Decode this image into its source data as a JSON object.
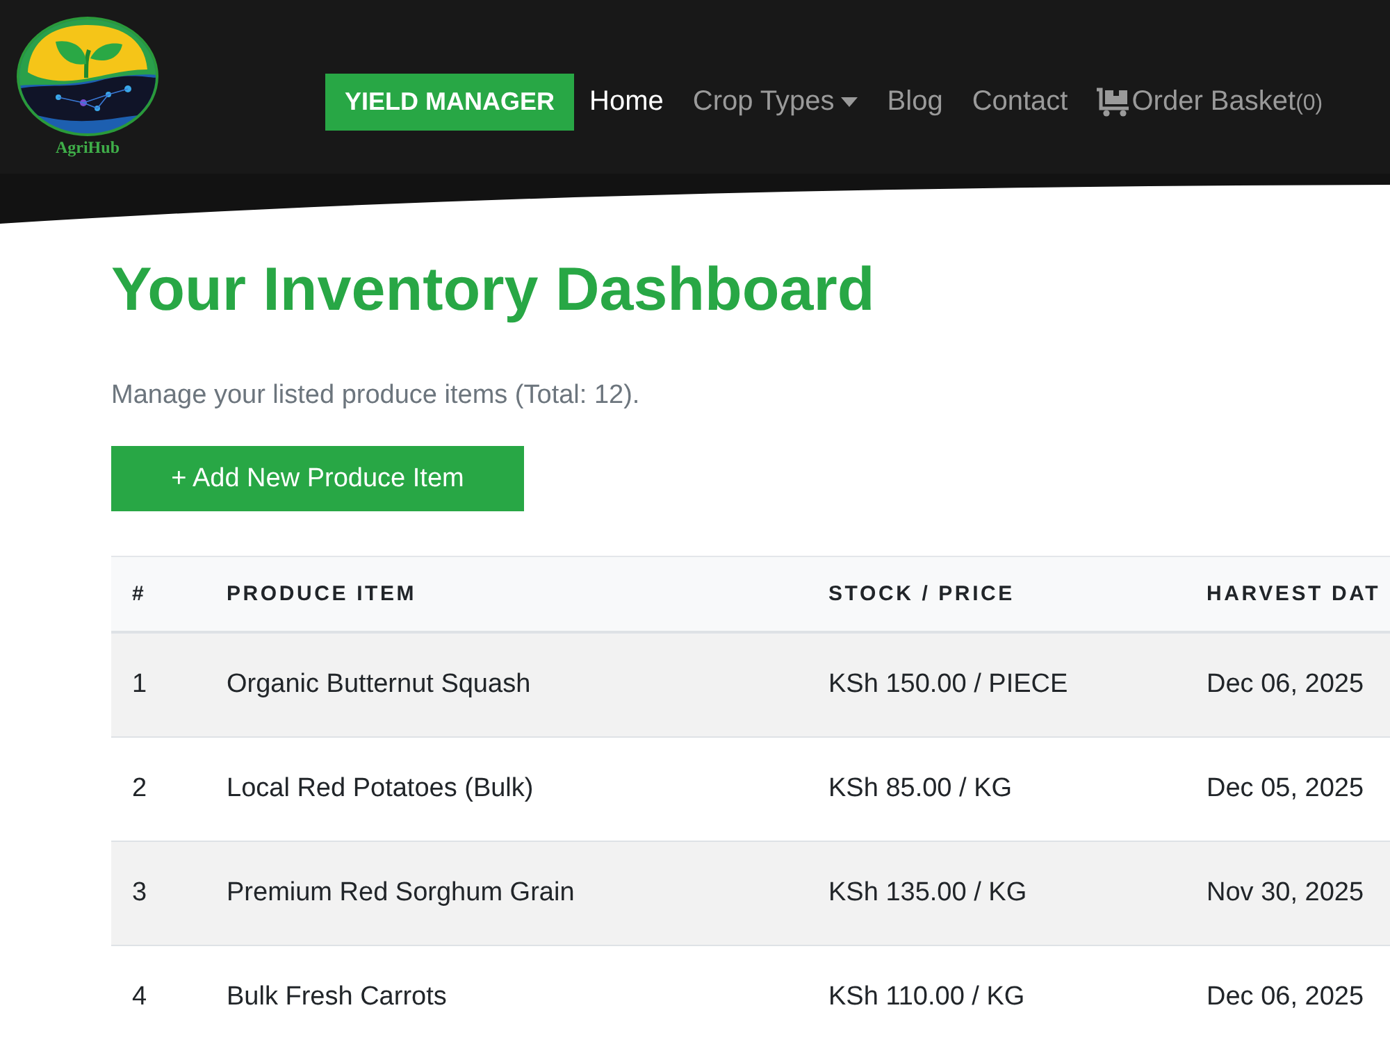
{
  "header": {
    "logo_text": "AgriHub",
    "badge": "YIELD MANAGER",
    "nav": [
      {
        "label": "Home",
        "kind": "link",
        "selected": true
      },
      {
        "label": "Crop Types",
        "kind": "dropdown",
        "selected": false
      },
      {
        "label": "Blog",
        "kind": "link",
        "selected": false
      },
      {
        "label": "Contact",
        "kind": "link",
        "selected": false
      },
      {
        "label": "Order Basket",
        "count": "(0)",
        "kind": "cart",
        "selected": false
      }
    ]
  },
  "page": {
    "title": "Your Inventory Dashboard",
    "subtitle": "Manage your listed produce items (Total: 12).",
    "add_button": "+ Add New Produce Item"
  },
  "table": {
    "columns": [
      "#",
      "PRODUCE ITEM",
      "STOCK / PRICE",
      "HARVEST DAT"
    ],
    "rows": [
      [
        "1",
        "Organic Butternut Squash",
        "KSh 150.00 / PIECE",
        "Dec 06, 2025"
      ],
      [
        "2",
        "Local Red Potatoes (Bulk)",
        "KSh 85.00 / KG",
        "Dec 05, 2025"
      ],
      [
        "3",
        "Premium Red Sorghum Grain",
        "KSh 135.00 / KG",
        "Nov 30, 2025"
      ],
      [
        "4",
        "Bulk Fresh Carrots",
        "KSh 110.00 / KG",
        "Dec 06, 2025"
      ]
    ]
  }
}
